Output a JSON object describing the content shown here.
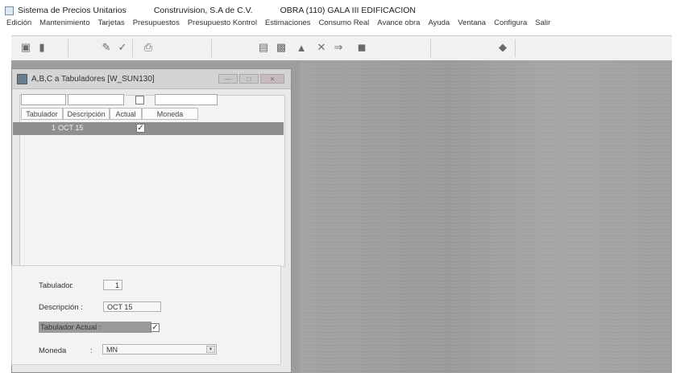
{
  "titlebar": {
    "app_name": "Sistema de Precios Unitarios",
    "company": "Construvision, S.A de C.V.",
    "project": "OBRA (110) GALA III EDIFICACION"
  },
  "menu": [
    "Edición",
    "Mantenimiento",
    "Tarjetas",
    "Presupuestos",
    "Presupuesto Kontrol",
    "Estimaciones",
    "Consumo Real",
    "Avance obra",
    "Ayuda",
    "Ventana",
    "Configura",
    "Salir"
  ],
  "toolbar_icons": [
    "print-preview-icon",
    "exit-door-icon",
    "edit-pencil-icon",
    "check-icon",
    "printer-icon",
    "copy-icon",
    "paste-icon",
    "insert-icon",
    "delete-x-icon",
    "arrow-icon",
    "trash-icon",
    "diamond-nav-icon"
  ],
  "child_window": {
    "title": "A,B,C a Tabuladores [W_SUN130]"
  },
  "grid": {
    "columns": [
      "Tabulador",
      "Descripción",
      "Actual",
      "Moneda"
    ],
    "rows": [
      {
        "tabulador": "1",
        "descripcion": "OCT 15",
        "actual": true,
        "moneda": ""
      }
    ]
  },
  "form": {
    "tabulador_label": "Tabulador",
    "tabulador_value": "1",
    "descripcion_label": "Descripción :",
    "descripcion_value": "OCT 15",
    "actual_label": "Tabulador Actual :",
    "actual_checked": true,
    "moneda_label": "Moneda",
    "moneda_value": "MN"
  }
}
